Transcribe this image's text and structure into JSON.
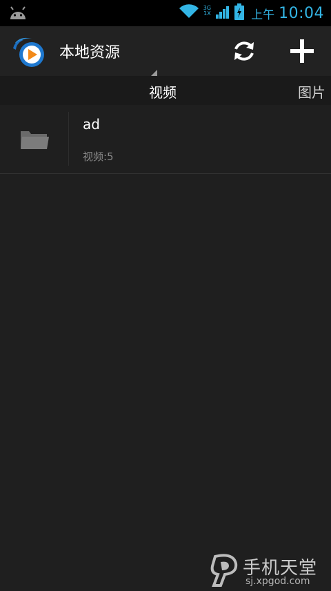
{
  "status_bar": {
    "network_type_top": "3G",
    "network_type_bottom": "1X",
    "ampm": "上午",
    "time": "10:04"
  },
  "action_bar": {
    "title": "本地资源"
  },
  "tabs": [
    {
      "label": "视频",
      "selected": true
    },
    {
      "label": "图片",
      "selected": false
    }
  ],
  "folders": [
    {
      "name": "ad",
      "count_label": "视频:5"
    }
  ],
  "watermark": {
    "title": "手机天堂",
    "url": "sj.xpgod.com"
  },
  "colors": {
    "accent": "#33b5e5",
    "background": "#1f1f1f"
  }
}
